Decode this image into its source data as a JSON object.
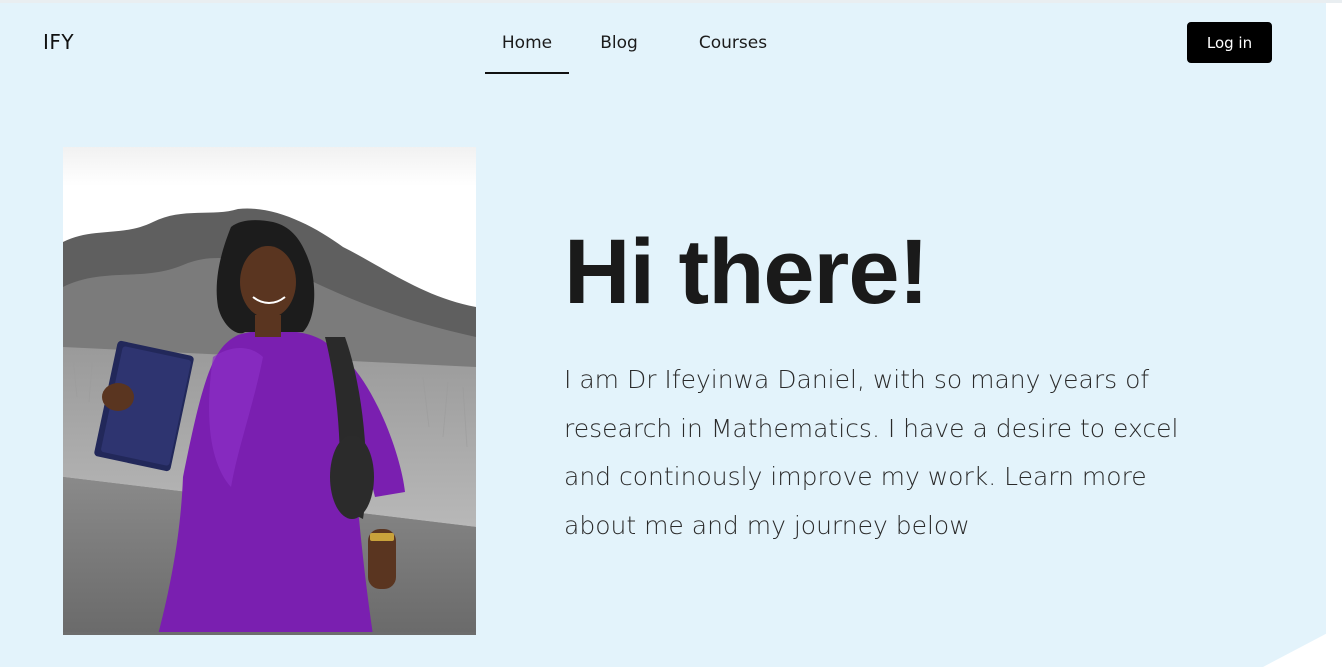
{
  "header": {
    "logo": "IFY",
    "nav": [
      {
        "label": "Home",
        "active": true
      },
      {
        "label": "Blog",
        "active": false
      },
      {
        "label": "Courses",
        "active": false
      }
    ],
    "login_label": "Log in"
  },
  "hero": {
    "heading": "Hi there!",
    "paragraph_lines": [
      "I am Dr Ifeyinwa Daniel, with so many years of",
      "research in Mathematics. I have a desire to excel",
      "and continously improve my work. Learn more",
      "about me and my journey below"
    ]
  },
  "colors": {
    "hero_background": "#e3f3fb",
    "button_background": "#000000",
    "text_dark": "#1a1a1a",
    "dress_purple": "#7a1fb0"
  }
}
